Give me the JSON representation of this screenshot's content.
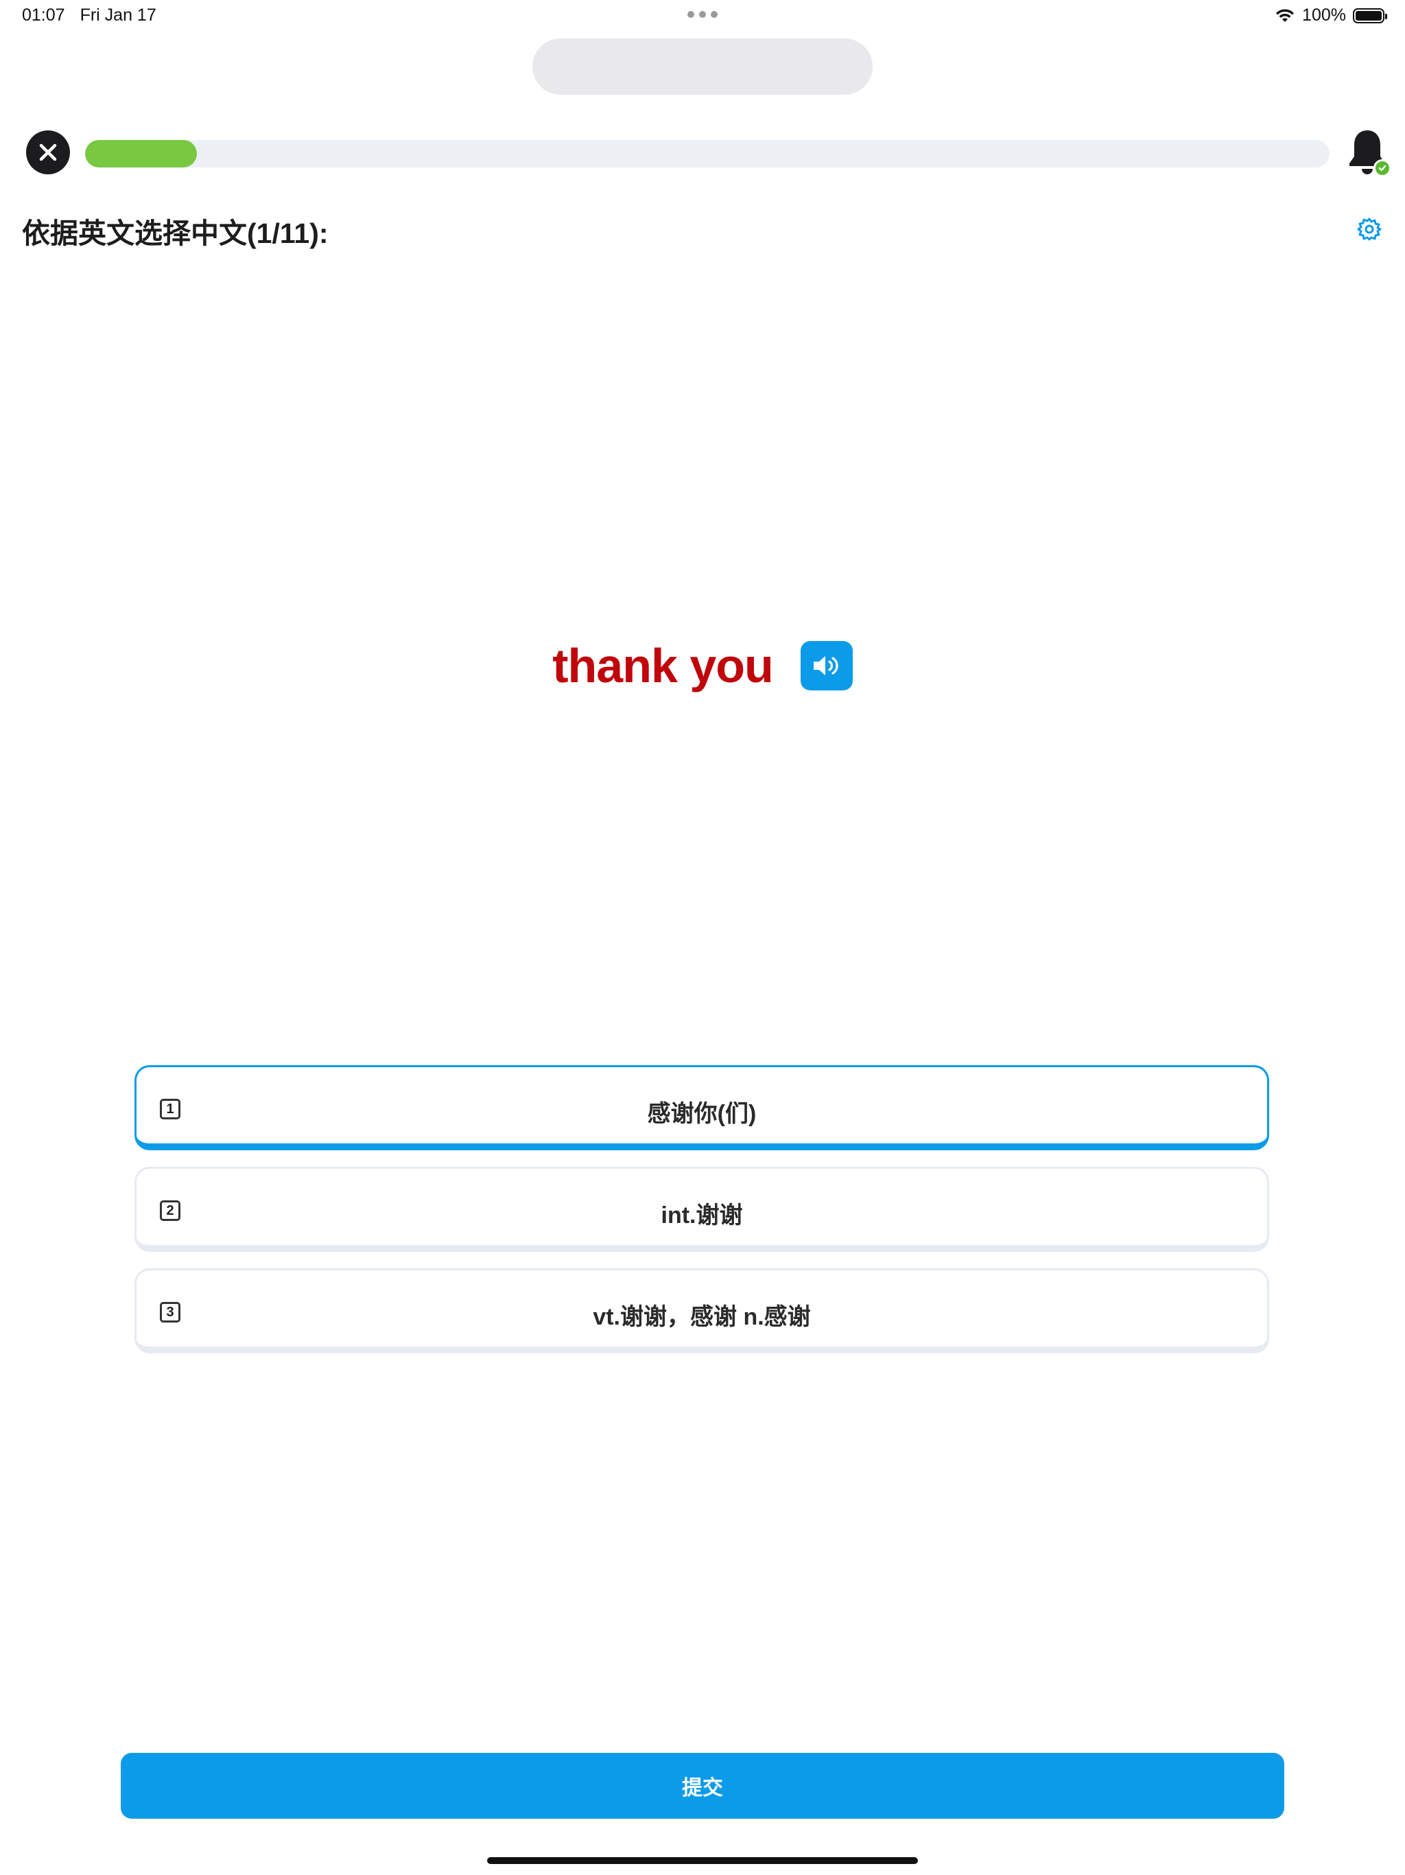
{
  "status_bar": {
    "time": "01:07",
    "date": "Fri Jan 17",
    "battery_percent": "100%",
    "battery_level": 1.0
  },
  "quiz": {
    "title": "依据英文选择中文(1/11):",
    "progress_fraction": 0.09,
    "word": "thank you",
    "colors": {
      "word": "#c0050b",
      "accent": "#0c9be8",
      "progress": "#78c841",
      "badge": "#5ab92f"
    },
    "options": [
      {
        "number": "1",
        "label": "感谢你(们)",
        "selected": true
      },
      {
        "number": "2",
        "label": "int.谢谢",
        "selected": false
      },
      {
        "number": "3",
        "label": "vt.谢谢，感谢 n.感谢",
        "selected": false
      }
    ],
    "submit_label": "提交"
  },
  "icons": {
    "close": "close-icon",
    "bell": "bell-icon",
    "settings": "gear-icon",
    "speaker": "speaker-icon",
    "wifi": "wifi-icon",
    "battery": "battery-icon"
  }
}
